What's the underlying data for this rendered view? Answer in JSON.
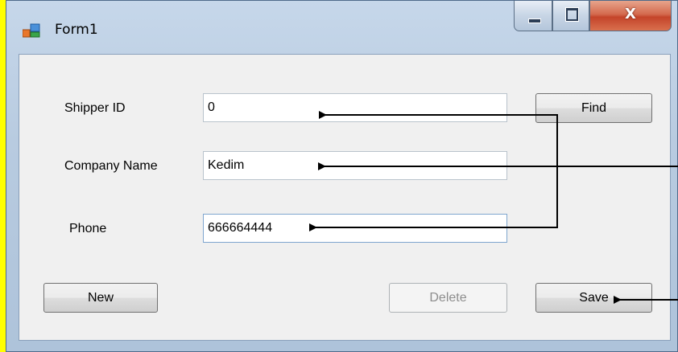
{
  "window": {
    "title": "Form1",
    "controls": {
      "minimize": "minimize-button",
      "maximize": "maximize-button",
      "close_label": "X"
    }
  },
  "form": {
    "shipper_id_label": "Shipper ID",
    "shipper_id_value": "0",
    "company_name_label": "Company Name",
    "company_name_value": "Kedim",
    "phone_label": "Phone",
    "phone_value": "666664444"
  },
  "buttons": {
    "find": "Find",
    "new": "New",
    "delete": "Delete",
    "save": "Save"
  },
  "colors": {
    "background": "#ffff00",
    "window_frame": "#b8cbe0",
    "client_area": "#f0f0f0",
    "close_button": "#c4442a",
    "arrow": "#000000"
  }
}
